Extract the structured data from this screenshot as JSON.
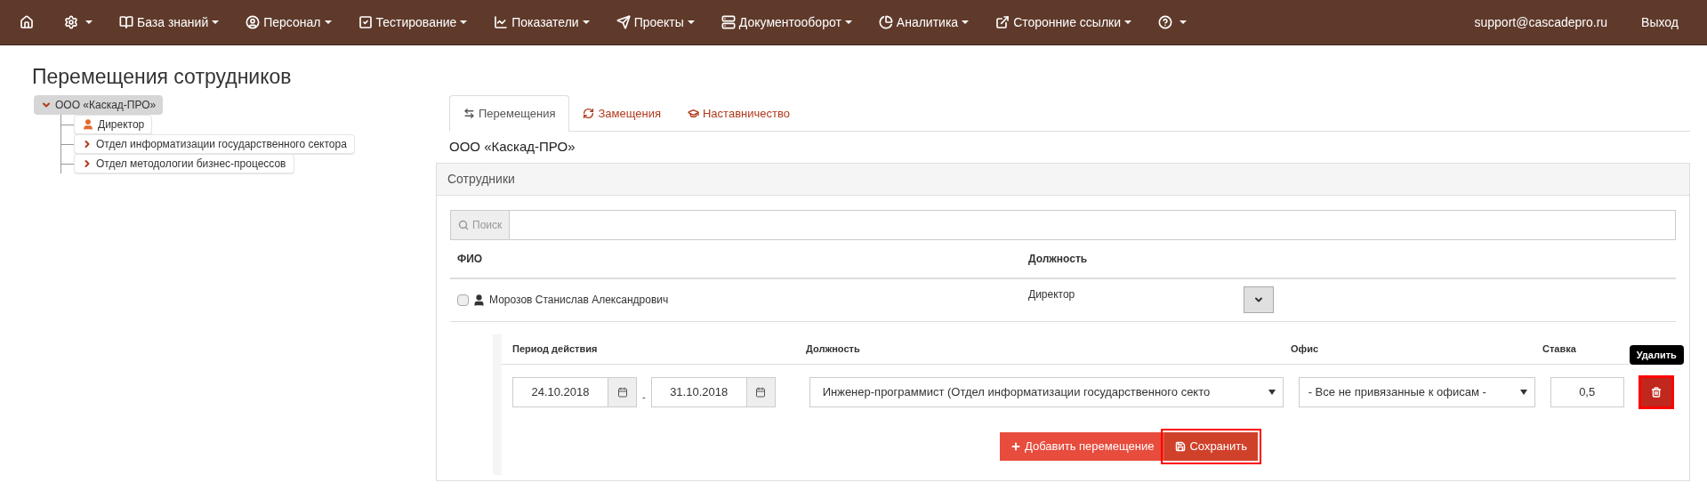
{
  "nav": {
    "items": [
      {
        "dropdown": false
      },
      {
        "dropdown": true
      },
      {
        "label": "База знаний",
        "dropdown": true
      },
      {
        "label": "Персонал",
        "dropdown": true
      },
      {
        "label": "Тестирование",
        "dropdown": true
      },
      {
        "label": "Показатели",
        "dropdown": true
      },
      {
        "label": "Проекты",
        "dropdown": true
      },
      {
        "label": "Документооборот",
        "dropdown": true
      },
      {
        "label": "Аналитика",
        "dropdown": true
      },
      {
        "label": "Сторонние ссылки",
        "dropdown": true
      },
      {
        "dropdown": true
      }
    ],
    "user": "support@cascadepro.ru",
    "logout": "Выход"
  },
  "page_title": "Перемещения сотрудников",
  "tree": {
    "label": "ООО «Каскад-ПРО»",
    "expanded": true,
    "selected": true,
    "children": [
      {
        "kind": "person",
        "label": "Директор"
      },
      {
        "kind": "department",
        "label": "Отдел информатизации государственного сектора",
        "expanded": false
      },
      {
        "kind": "department",
        "label": "Отдел методологии бизнес-процессов",
        "expanded": false
      }
    ]
  },
  "tabs": [
    {
      "label": "Перемещения",
      "selected": true
    },
    {
      "label": "Замещения",
      "selected": false
    },
    {
      "label": "Наставничество",
      "selected": false
    }
  ],
  "org_title": "ООО «Каскад-ПРО»",
  "panel": {
    "title": "Сотрудники",
    "search": {
      "label": "Поиск"
    },
    "table": {
      "columns": [
        "ФИО",
        "Должность"
      ],
      "rows": [
        {
          "checked": false,
          "name": "Морозов Станислав Александрович",
          "position": "Директор",
          "expanded": true
        }
      ]
    },
    "transfer_form": {
      "columns": [
        "Период действия",
        "Должность",
        "Офис",
        "Ставка"
      ],
      "date_from": "24.10.2018",
      "separator": "-",
      "date_to": "31.10.2018",
      "position": "Инженер-программист (Отдел информатизации государственного секто",
      "office": "- Все не привязанные к офисам -",
      "rate": "0,5",
      "delete": {
        "tooltip": "Удалить",
        "highlighted": true
      },
      "buttons": [
        {
          "kind": "add",
          "label": "Добавить перемещение",
          "highlighted": false
        },
        {
          "kind": "save",
          "label": "Сохранить",
          "highlighted": true
        }
      ]
    }
  }
}
